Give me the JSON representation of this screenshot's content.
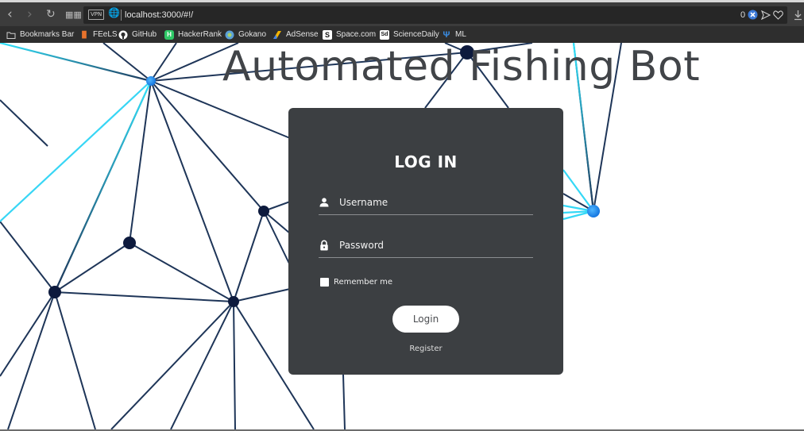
{
  "browser": {
    "url": "localhost:3000/#!/",
    "vpn_label": "VPN",
    "blocked_count": "0",
    "bookmarks": [
      {
        "label": "Bookmarks Bar",
        "icon": "folder-icon",
        "color": "#cfcfcf"
      },
      {
        "label": "FEeLS",
        "icon": "feels-icon",
        "color": "#e8732c"
      },
      {
        "label": "GitHub",
        "icon": "github-icon",
        "color": "#ffffff"
      },
      {
        "label": "HackerRank",
        "icon": "hackerrank-icon",
        "color": "#2ec866"
      },
      {
        "label": "Gokano",
        "icon": "gokano-icon",
        "color": "#5aa0d8"
      },
      {
        "label": "AdSense",
        "icon": "adsense-icon",
        "color": "#f4b400"
      },
      {
        "label": "Space.com",
        "icon": "space-icon",
        "color": "#ffffff"
      },
      {
        "label": "ScienceDaily",
        "icon": "sciencedaily-icon",
        "color": "#ffffff"
      },
      {
        "label": "ML",
        "icon": "ml-icon",
        "color": "#3a8ee6"
      }
    ]
  },
  "page": {
    "title": "Automated Fishing Bot"
  },
  "login": {
    "heading": "LOG IN",
    "username_placeholder": "Username",
    "password_placeholder": "Password",
    "remember_label": "Remember me",
    "remember_checked": false,
    "login_button": "Login",
    "register_link": "Register"
  },
  "colors": {
    "card_bg": "#3c3f42",
    "line": "#1e3558",
    "node_dark": "#0d1a3d",
    "node_accent": "#1f8fff",
    "line_glow": "#31e6ff"
  }
}
